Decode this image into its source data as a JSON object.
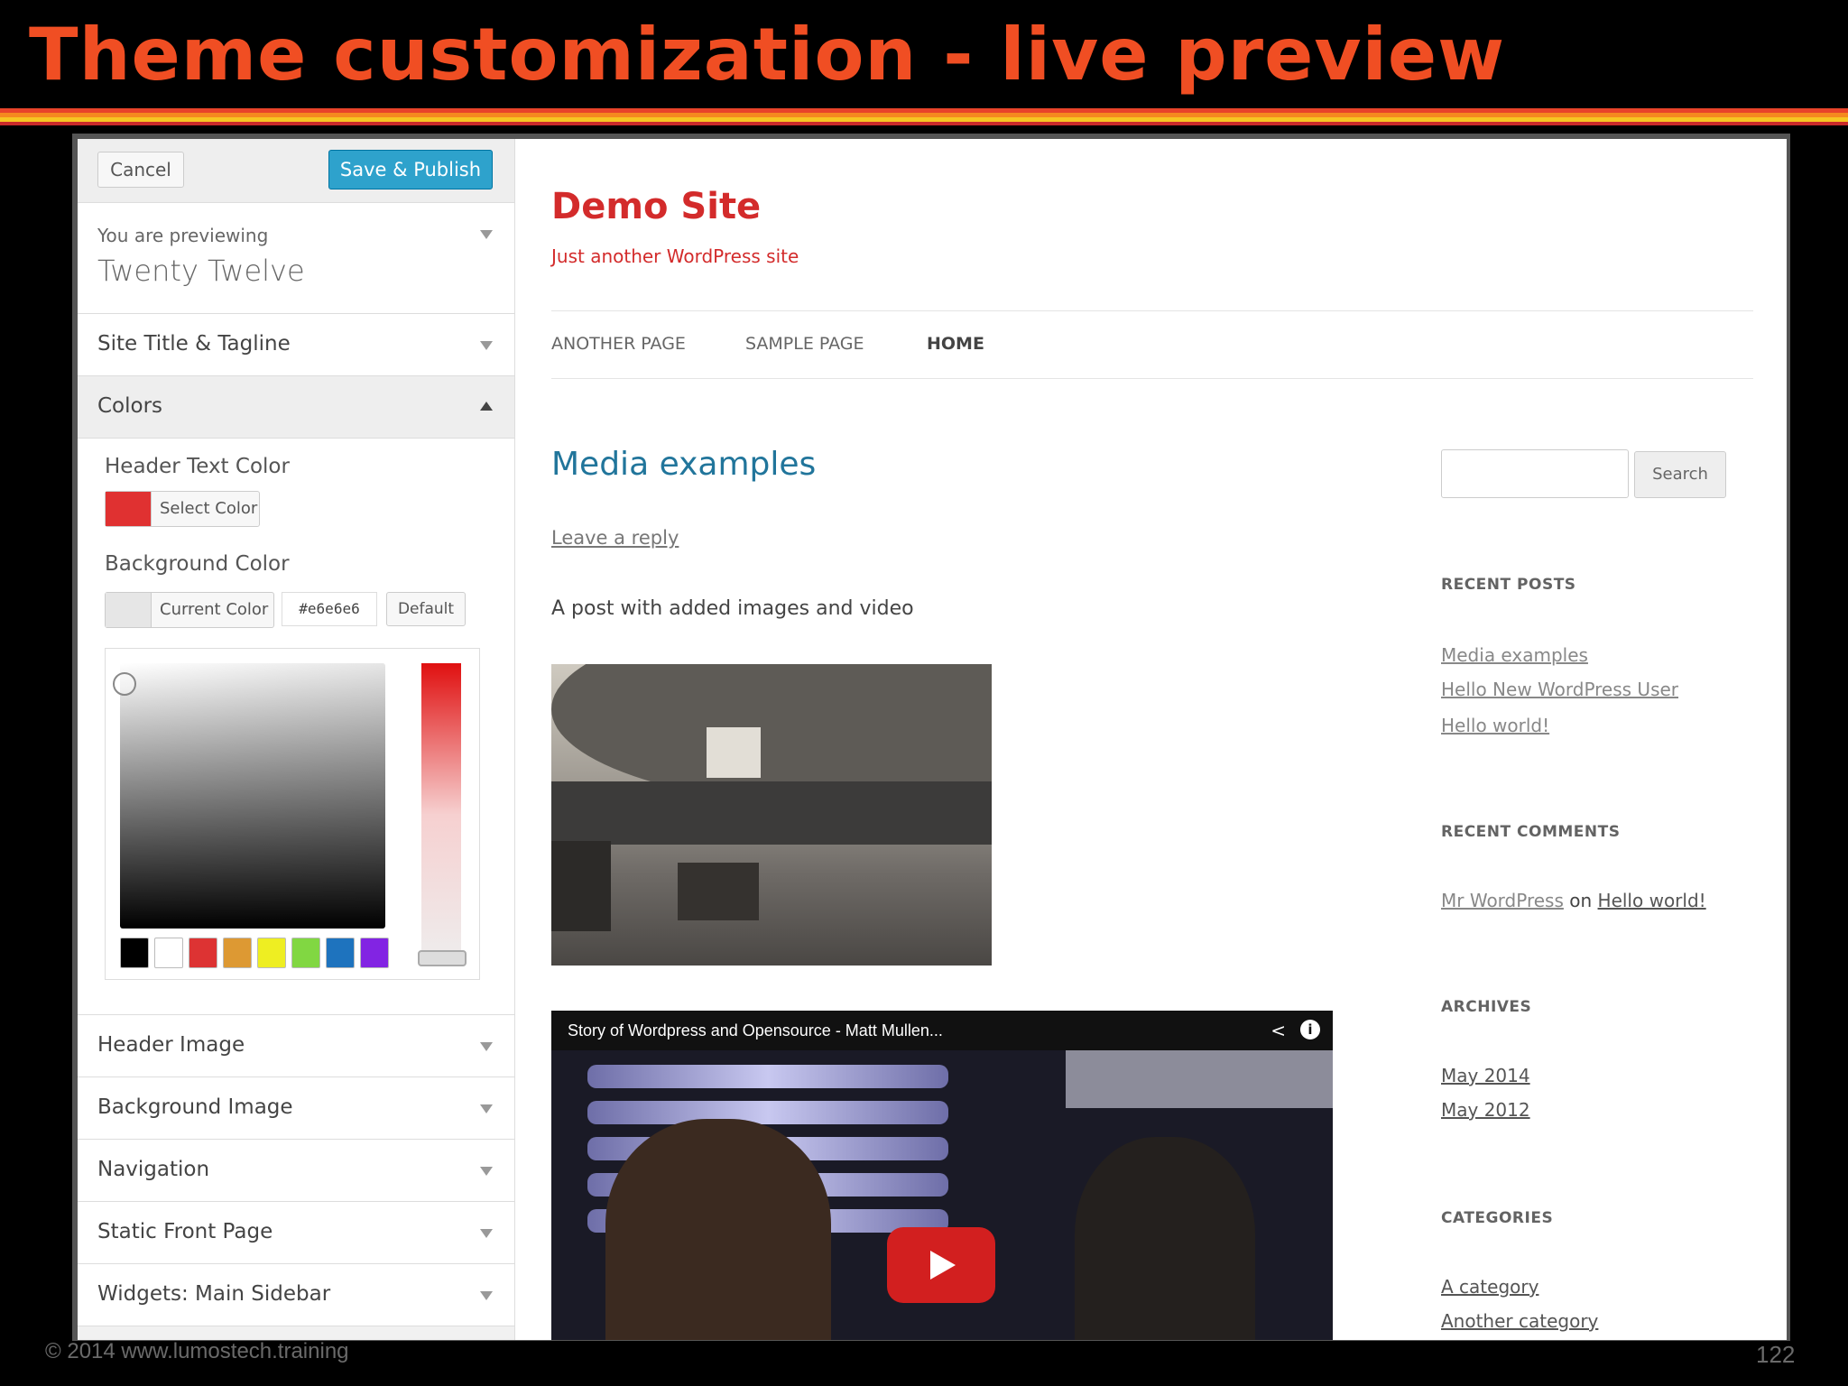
{
  "slide": {
    "title": "Theme customization - live preview",
    "footer": "© 2014  www.lumostech.training",
    "page_number": "122",
    "accent_colors": [
      "#e8442a",
      "#f58a1f",
      "#f6c623",
      "#c92a2a"
    ]
  },
  "customizer": {
    "cancel_label": "Cancel",
    "save_label": "Save & Publish",
    "previewing_label": "You are previewing",
    "theme_name": "Twenty Twelve",
    "sections": {
      "site_title": "Site Title & Tagline",
      "colors": "Colors",
      "header_image": "Header Image",
      "background_image": "Background Image",
      "navigation": "Navigation",
      "static_front_page": "Static Front Page",
      "widgets": "Widgets: Main Sidebar"
    },
    "colors": {
      "header_text_title": "Header Text Color",
      "header_select_label": "Select Color",
      "header_text_color": "#e03131",
      "background_title": "Background Color",
      "background_current_label": "Current Color",
      "background_hex": "#e6e6e6",
      "default_label": "Default",
      "palette": [
        "#000000",
        "#ffffff",
        "#dd3333",
        "#dd9933",
        "#eeee22",
        "#81d742",
        "#1e73be",
        "#8224e3"
      ]
    }
  },
  "site": {
    "title": "Demo Site",
    "tagline": "Just another WordPress site",
    "nav": [
      "ANOTHER PAGE",
      "SAMPLE PAGE",
      "HOME"
    ],
    "post": {
      "title": "Media examples",
      "reply_link": "Leave a reply",
      "text": "A post with added images and video"
    },
    "video_title": "Story of Wordpress and Opensource - Matt Mullen...",
    "sidebar": {
      "search_button": "Search",
      "recent_posts_title": "RECENT POSTS",
      "recent_posts": [
        "Media examples",
        "Hello New WordPress User",
        "Hello world!"
      ],
      "recent_comments_title": "RECENT COMMENTS",
      "comment_author": "Mr WordPress",
      "comment_on": "on",
      "comment_post": "Hello world!",
      "archives_title": "ARCHIVES",
      "archives": [
        "May 2014",
        "May 2012"
      ],
      "categories_title": "CATEGORIES",
      "categories": [
        "A category",
        "Another category"
      ]
    }
  }
}
